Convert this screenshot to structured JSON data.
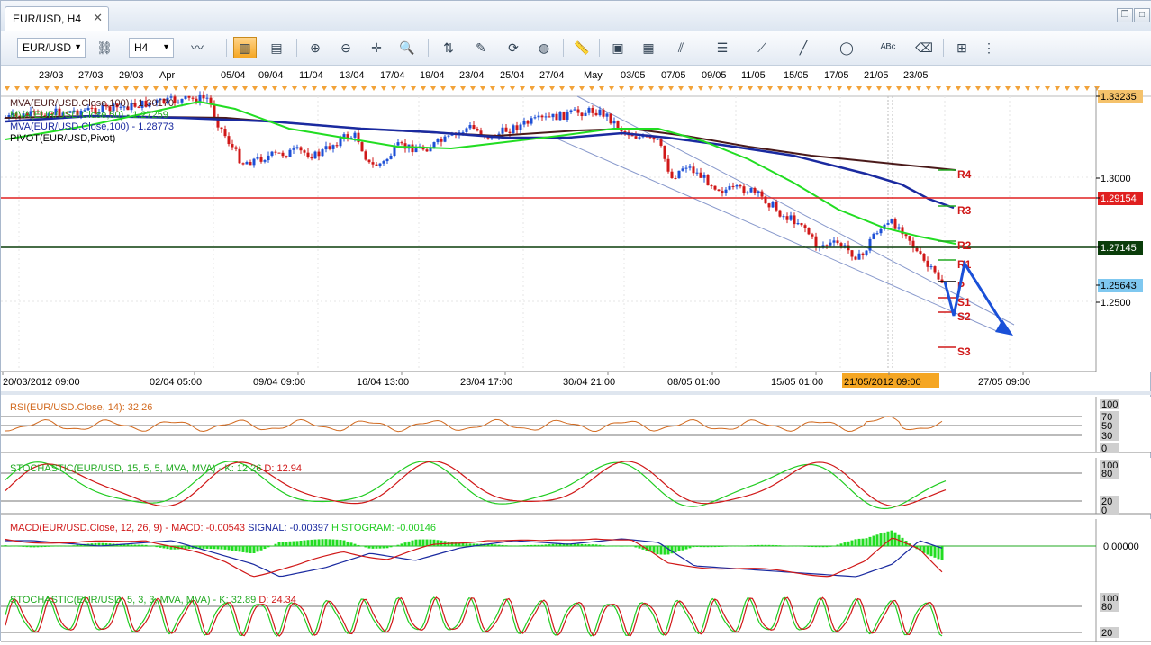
{
  "window": {
    "tab_title": "EUR/USD, H4"
  },
  "toolbar": {
    "symbol": "EUR/USD",
    "timeframe": "H4"
  },
  "top_dates": [
    "23/03",
    "27/03",
    "29/03",
    "Apr",
    "05/04",
    "09/04",
    "11/04",
    "13/04",
    "17/04",
    "19/04",
    "23/04",
    "25/04",
    "27/04",
    "May",
    "03/05",
    "07/05",
    "09/05",
    "11/05",
    "15/05",
    "17/05",
    "21/05",
    "23/05"
  ],
  "main_chart": {
    "legend": [
      {
        "text": "MVA(EUR/USD.Close,100) - 1.30170",
        "color": "#4a1a1a"
      },
      {
        "text": "MVA(EUR/USD.Close,50) - 1.27259",
        "color": "#22aa22"
      },
      {
        "text": "MVA(EUR/USD.Close,100) - 1.28773",
        "color": "#1a2aa0"
      },
      {
        "text": "PIVOT(EUR/USD,Pivot)",
        "color": "#000000"
      }
    ],
    "pivot_labels": [
      "R4",
      "R3",
      "R2",
      "R1",
      "P",
      "S1",
      "S2",
      "S3"
    ],
    "price_labels": [
      {
        "text": "1.33235",
        "bg": "#f5c26b",
        "fg": "#000000"
      },
      {
        "text": "1.3000",
        "bg": "",
        "fg": "#000000"
      },
      {
        "text": "1.29154",
        "bg": "#e02020",
        "fg": "#ffffff"
      },
      {
        "text": "1.27145",
        "bg": "#0a3d0a",
        "fg": "#ffffff"
      },
      {
        "text": "1.25643",
        "bg": "#7fc8f0",
        "fg": "#000000"
      },
      {
        "text": "1.2500",
        "bg": "",
        "fg": "#000000"
      }
    ],
    "time_axis": [
      "20/03/2012 09:00",
      "02/04 05:00",
      "09/04 09:00",
      "16/04 13:00",
      "23/04 17:00",
      "30/04 21:00",
      "08/05 01:00",
      "15/05 01:00",
      "21/05/2012 09:00",
      "27/05 09:00"
    ]
  },
  "rsi_panel": {
    "label": "RSI(EUR/USD.Close, 14): 32.26",
    "scale": [
      "100",
      "70",
      "50",
      "30",
      "0"
    ]
  },
  "stoch1_panel": {
    "label_prefix": "STOCHASTIC(EUR/USD, 15, 5, 5, MVA, MVA) -",
    "k": "K: 12.26",
    "d": "D: 12.94",
    "scale": [
      "100",
      "80",
      "20",
      "0"
    ]
  },
  "macd_panel": {
    "label_prefix": "MACD(EUR/USD.Close, 12, 26, 9) -",
    "macd": "MACD: -0.00543",
    "signal": "SIGNAL: -0.00397",
    "histogram": "HISTOGRAM: -0.00146",
    "scale": "0.00000"
  },
  "stoch2_panel": {
    "label_prefix": "STOCHASTIC(EUR/USD, 5, 3, 3, MVA, MVA) -",
    "k": "K: 32.89",
    "d": "D: 24.34",
    "scale": [
      "100",
      "80",
      "20"
    ]
  },
  "colors": {
    "up_candle": "#1d4fd6",
    "down_candle": "#d01818",
    "sma_green": "#22dd22",
    "sma_blue": "#1a2aa0",
    "sma_brown": "#4a1a1a",
    "forecast_arrow": "#1a50d8"
  }
}
